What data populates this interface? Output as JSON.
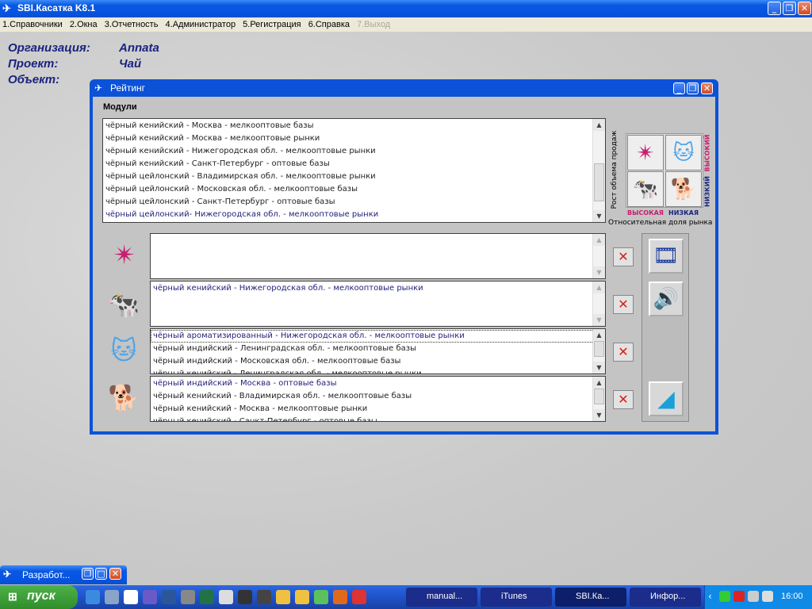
{
  "app": {
    "title": "SBI.Касатка K8.1"
  },
  "menu": [
    "1.Справочники",
    "2.Окна",
    "3.Отчетность",
    "4.Администратор",
    "5.Регистрация",
    "6.Справка",
    "7.Выход"
  ],
  "info": {
    "org_label": "Организация:",
    "org_value": "Annata",
    "proj_label": "Проект:",
    "proj_value": "Чай",
    "obj_label": "Объект:"
  },
  "dialog": {
    "title": "Рейтинг",
    "modules_label": "Модули",
    "modules": [
      "чёрный кенийский - Москва - мелкооптовые базы",
      "чёрный кенийский - Москва - мелкооптовые рынки",
      "чёрный кенийский - Нижегородская обл. - мелкооптовые рынки",
      "чёрный кенийский - Санкт-Петербург - оптовые базы",
      "чёрный цейлонский - Владимирская обл. - мелкооптовые рынки",
      "чёрный цейлонский - Московская обл. - мелкооптовые базы",
      "чёрный цейлонский - Санкт-Петербург - оптовые базы",
      "чёрный цейлонский- Нижегородская обл. - мелкооптовые рынки"
    ],
    "matrix": {
      "y_axis": "Рост объема продаж",
      "x_axis": "Относительная доля рынка",
      "high_y": "высокий",
      "low_y": "низкий",
      "high_x": "высокая",
      "low_x": "низкая"
    },
    "star_list": [],
    "cow_list": [
      "чёрный кенийский - Нижегородская обл. - мелкооптовые рынки"
    ],
    "cat_list": [
      "чёрный ароматизированный - Нижегородская обл. - мелкооптовые рынки",
      "чёрный индийский - Ленинградская обл. - мелкооптовые базы",
      "чёрный индийский - Московская обл. - мелкооптовые базы",
      "чёрный кенийский - Ленинградская обл. - мелкооптовые рынки"
    ],
    "dog_list": [
      "чёрный индийский - Москва - оптовые базы",
      "чёрный кенийский - Владимирская обл. - мелкооптовые базы",
      "чёрный кенийский - Москва - мелкооптовые рынки",
      "чёрный кенийский - Санкт-Петербург - оптовые базы"
    ]
  },
  "minimized": {
    "title": "Разработ..."
  },
  "taskbar": {
    "start": "пуск",
    "tasks": [
      "manual...",
      "iTunes",
      "SBI.Ка...",
      "Инфор..."
    ],
    "clock": "16:00"
  }
}
